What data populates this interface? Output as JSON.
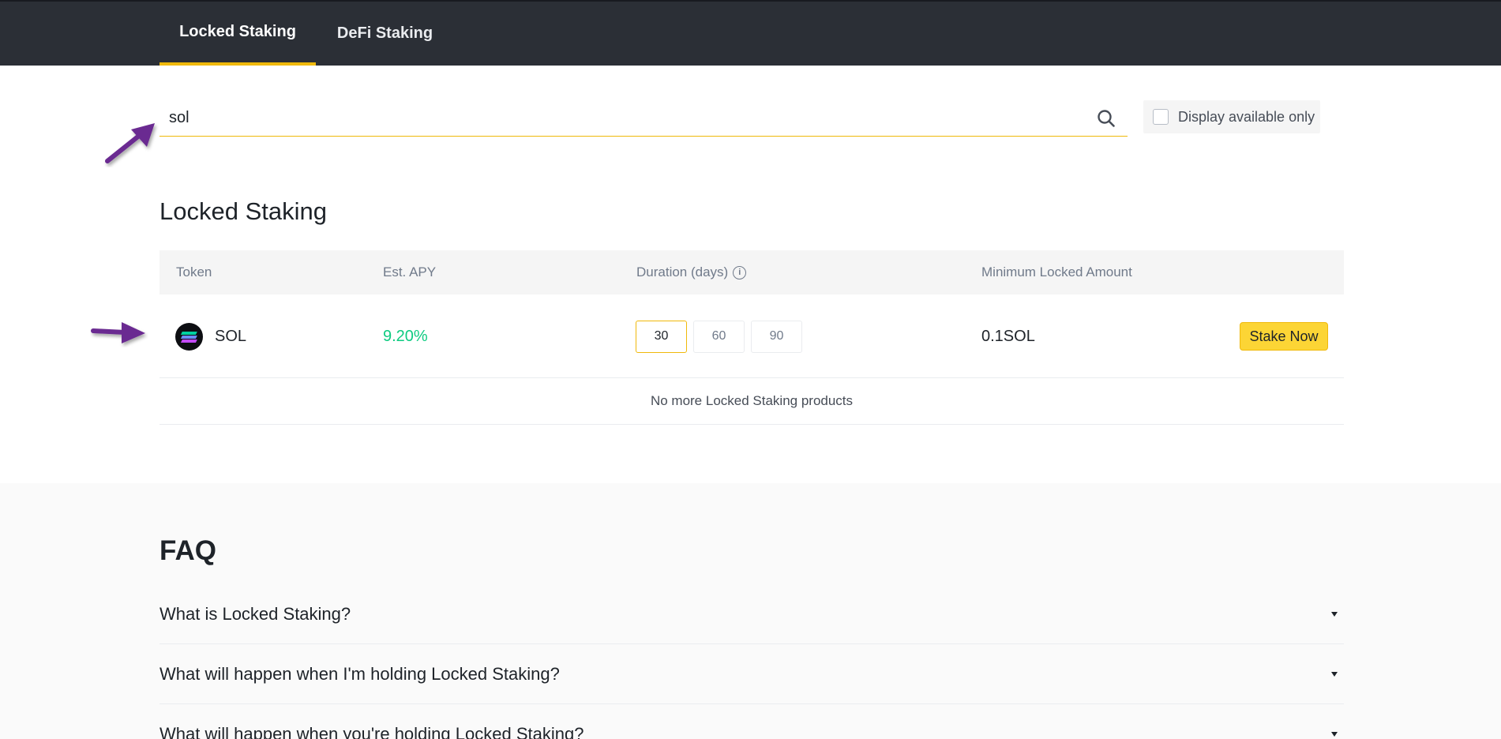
{
  "tabs": [
    {
      "label": "Locked Staking",
      "active": true
    },
    {
      "label": "DeFi Staking",
      "active": false
    }
  ],
  "search": {
    "value": "sol",
    "placeholder": ""
  },
  "filter": {
    "label": "Display available only",
    "checked": false
  },
  "section": {
    "title": "Locked Staking"
  },
  "table": {
    "columns": [
      "Token",
      "Est. APY",
      "Duration (days)",
      "Minimum Locked Amount"
    ],
    "rows": [
      {
        "token": "SOL",
        "apy": "9.20%",
        "durations": [
          "30",
          "60",
          "90"
        ],
        "selected_duration": "30",
        "min_amount": "0.1SOL",
        "action": "Stake Now"
      }
    ],
    "footer": "No more Locked Staking products"
  },
  "faq": {
    "title": "FAQ",
    "items": [
      "What is Locked Staking?",
      "What will happen when I'm holding Locked Staking?",
      "What will happen when you're holding Locked Staking?"
    ]
  },
  "colors": {
    "accent": "#f0b90b",
    "topbar": "#2b2f36",
    "apy_green": "#0ecb81",
    "annotation_arrow": "#6b2c91"
  },
  "icons": [
    "search-icon",
    "info-icon",
    "sol-token-icon",
    "chevron-down-icon"
  ]
}
